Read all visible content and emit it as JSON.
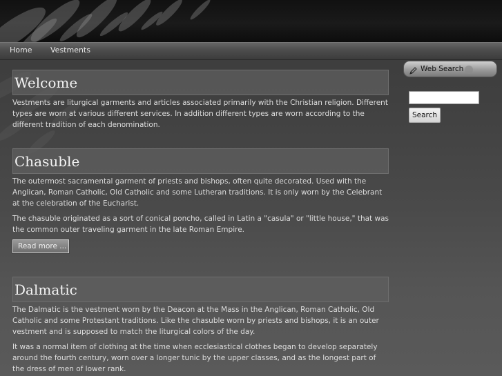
{
  "nav": {
    "items": [
      {
        "label": "Home"
      },
      {
        "label": "Vestments"
      }
    ]
  },
  "posts": [
    {
      "title": "Welcome",
      "paragraphs": [
        "Vestments are liturgical garments and articles associated primarily with the Christian religion. Different types are worn at various different services. In addition different types are worn according to the different tradition of each denomination."
      ]
    },
    {
      "title": "Chasuble",
      "paragraphs": [
        "The outermost sacramental garment of priests and bishops, often quite decorated. Used with the Anglican, Roman Catholic, Old Catholic and some Lutheran traditions. It is only worn by the Celebrant at the celebration of the Eucharist.",
        "The chasuble originated as a sort of conical poncho, called in Latin a \"casula\" or \"little house,\" that was the common outer traveling garment in the late Roman Empire."
      ],
      "read_more": "Read more ..."
    },
    {
      "title": "Dalmatic",
      "paragraphs": [
        "The Dalmatic is the vestment worn by the Deacon at the Mass in the Anglican, Roman Catholic, Old Catholic and some Protestant traditions. Like the chasuble worn by priests and bishops, it is an outer vestment and is supposed to match the liturgical colors of the day.",
        "It was a normal item of clothing at the time when ecclesiastical clothes began to develop separately around the fourth century, worn over a longer tunic by the upper classes, and as the longest part of the dress of men of lower rank."
      ]
    }
  ],
  "sidebar": {
    "search": {
      "title": "Web Search",
      "icon": "pencil-icon",
      "input_value": "",
      "button_label": "Search"
    }
  }
}
